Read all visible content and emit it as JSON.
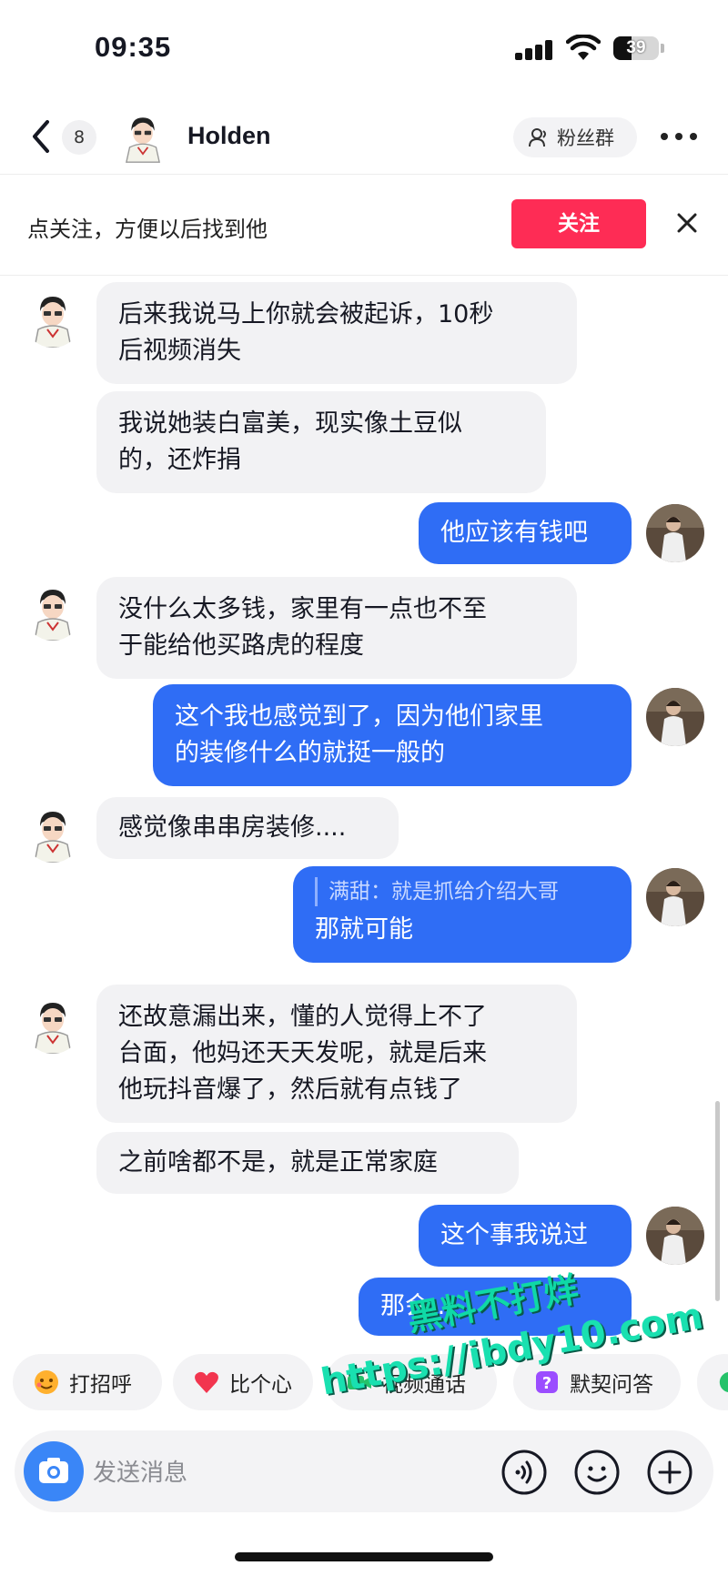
{
  "status_bar": {
    "time": "09:35",
    "battery": "39"
  },
  "header": {
    "unread_count": "8",
    "contact_name": "Holden",
    "fans_group_label": "粉丝群"
  },
  "follow_banner": {
    "text": "点关注，方便以后找到他",
    "button_label": "关注"
  },
  "messages": [
    {
      "side": "in",
      "lines": [
        "后来我说马上你就会被起诉，10秒",
        "后视频消失"
      ]
    },
    {
      "side": "in",
      "lines": [
        "我说她装白富美，现实像土豆似",
        "的，还炸捐"
      ]
    },
    {
      "side": "out",
      "lines": [
        "他应该有钱吧"
      ]
    },
    {
      "side": "in",
      "lines": [
        "没什么太多钱，家里有一点也不至",
        "于能给他买路虎的程度"
      ]
    },
    {
      "side": "out",
      "lines": [
        "这个我也感觉到了，因为他们家里",
        "的装修什么的就挺一般的"
      ]
    },
    {
      "side": "in",
      "lines": [
        "感觉像串串房装修...."
      ]
    },
    {
      "side": "out",
      "quote": "满甜：就是抓给介绍大哥",
      "lines": [
        "那就可能"
      ]
    },
    {
      "side": "in",
      "lines": [
        "还故意漏出来，懂的人觉得上不了",
        "台面，他妈还天天发呢，就是后来",
        "他玩抖音爆了，然后就有点钱了"
      ]
    },
    {
      "side": "in",
      "lines": [
        "之前啥都不是，就是正常家庭"
      ]
    },
    {
      "side": "out",
      "lines": [
        "这个事我说过"
      ]
    },
    {
      "side": "out",
      "lines": [
        "那会..."
      ]
    }
  ],
  "quick_replies": [
    {
      "label": "打招呼",
      "icon": "wave-icon"
    },
    {
      "label": "比个心",
      "icon": "heart-icon"
    },
    {
      "label": "视频通话",
      "icon": "video-call-icon"
    },
    {
      "label": "默契问答",
      "icon": "quiz-icon"
    }
  ],
  "input": {
    "placeholder": "发送消息"
  },
  "watermark": {
    "line1": "黑料不打烊",
    "line2": "https://ibdy10.com"
  },
  "colors": {
    "accent_red": "#fe2c55",
    "bubble_out": "#2f6df5",
    "bubble_in": "#f2f2f4"
  }
}
